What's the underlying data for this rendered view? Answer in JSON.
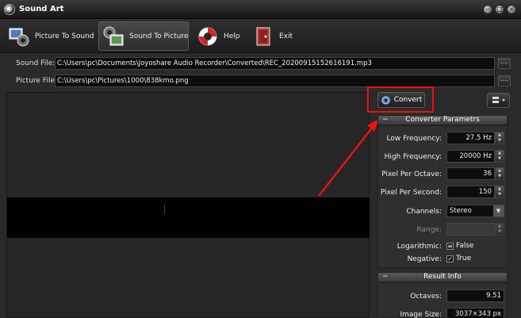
{
  "window": {
    "title": "Sound Art"
  },
  "toolbar": {
    "picture_to_sound": "Picture To Sound",
    "sound_to_picture": "Sound To Picture",
    "help": "Help",
    "exit": "Exit"
  },
  "files": {
    "sound_label": "Sound File:",
    "sound_path": "C:\\Users\\pc\\Documents\\Joyoshare Audio Recorder\\Converted\\REC_20200915152616191.mp3",
    "picture_label": "Picture File:",
    "picture_path": "C:\\Users\\pc\\Pictures\\1000\\838kmo.png",
    "browse": "...."
  },
  "convert": {
    "label": "Convert"
  },
  "params": {
    "header": "Converter Parametrs",
    "low_freq_label": "Low Frequency:",
    "low_freq": "27.5 Hz",
    "high_freq_label": "High Frequency:",
    "high_freq": "20000 Hz",
    "ppo_label": "Pixel Per Octave:",
    "ppo": "36",
    "pps_label": "Pixel Per Second:",
    "pps": "150",
    "channels_label": "Channels:",
    "channels": "Stereo",
    "range_label": "Range:",
    "range": "",
    "log_label": "Logarithmic:",
    "log": "False",
    "neg_label": "Negative:",
    "neg": "True"
  },
  "result": {
    "header": "Result Info",
    "octaves_label": "Octaves:",
    "octaves": "9.51",
    "size_label": "Image Size:",
    "size": "3037×343 px"
  },
  "colors": {
    "highlight": "#e11111",
    "arrow": "#e11111"
  }
}
